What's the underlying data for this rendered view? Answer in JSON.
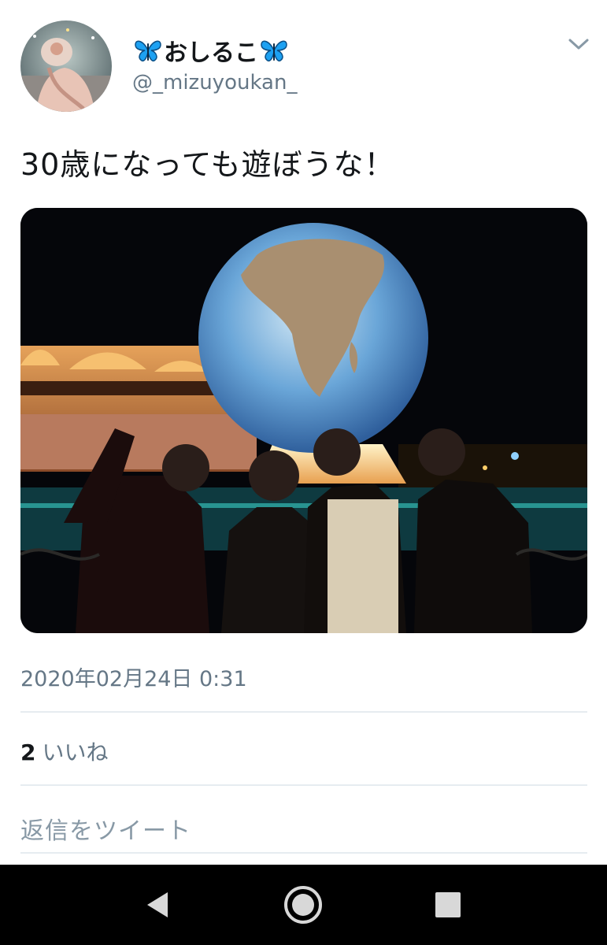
{
  "user": {
    "display_name": "おしるこ",
    "handle": "@_mizuyoukan_",
    "avatar_icon": "profile-avatar",
    "name_decoration_icon": "butterfly-icon"
  },
  "tweet": {
    "text": "30歳になっても遊ぼうな！",
    "media_description": "photo",
    "timestamp": "2020年02月24日 0:31"
  },
  "stats": {
    "likes_count": "2",
    "likes_label": "いいね"
  },
  "reply": {
    "placeholder": "返信をツイート"
  },
  "navbar": {
    "back_icon": "back-triangle-icon",
    "home_icon": "home-circle-icon",
    "recents_icon": "recents-square-icon"
  },
  "colors": {
    "text_primary": "#14171a",
    "text_secondary": "#657786",
    "butterfly": "#1da1f2",
    "divider": "#e6ecf0",
    "navbar_bg": "#000000"
  }
}
